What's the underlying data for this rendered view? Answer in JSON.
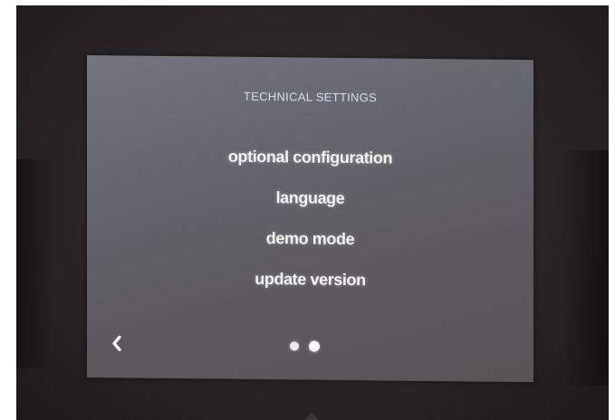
{
  "screen": {
    "title": "TECHNICAL SETTINGS",
    "menu_items": [
      {
        "label": "optional configuration"
      },
      {
        "label": "language"
      },
      {
        "label": "demo mode"
      },
      {
        "label": "update version"
      }
    ],
    "back_icon": "chevron-left-icon",
    "pagination": {
      "pages": 2,
      "current": 2
    }
  },
  "colors": {
    "screen_bg": "#65656d",
    "title_text": "#cfe0f5",
    "menu_text": "#f4f4f6",
    "bezel": "#2a2426"
  }
}
